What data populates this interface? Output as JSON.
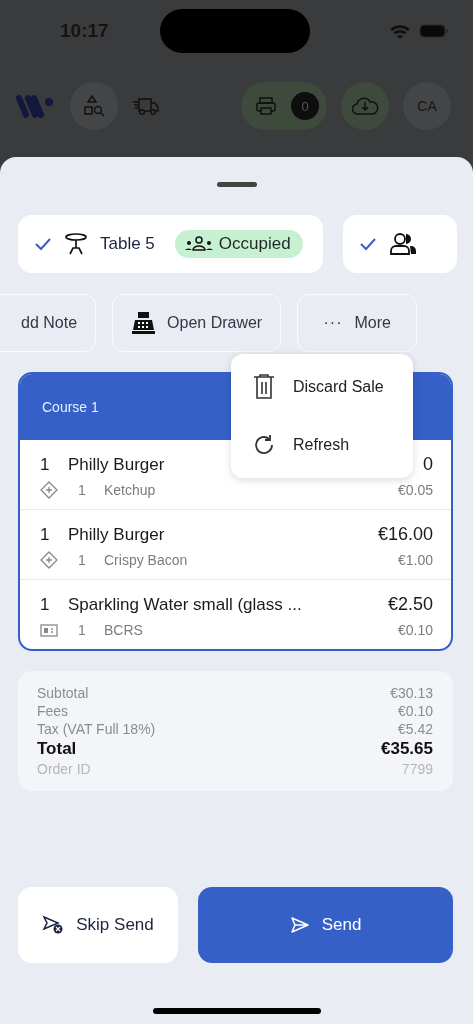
{
  "status_bar": {
    "time": "10:17"
  },
  "top_bar": {
    "print_count": "0",
    "avatar": "CA"
  },
  "chips": [
    {
      "kind": "table",
      "checked": true,
      "label": "Table 5",
      "status": "Occupied"
    },
    {
      "kind": "guests",
      "checked": true
    }
  ],
  "actions": [
    {
      "kind": "note",
      "label": "dd Note"
    },
    {
      "kind": "drawer",
      "label": "Open Drawer"
    },
    {
      "kind": "more",
      "icon": "···",
      "label": "More"
    }
  ],
  "menu": [
    {
      "kind": "trash",
      "label": "Discard Sale"
    },
    {
      "kind": "refresh",
      "label": "Refresh"
    }
  ],
  "course": {
    "title": "Course 1",
    "items": [
      {
        "qty": "1",
        "name": "Philly Burger",
        "price": "0",
        "modifier": {
          "kind": "addon",
          "qty": "1",
          "name": "Ketchup",
          "price": "€0.05"
        }
      },
      {
        "qty": "1",
        "name": "Philly Burger",
        "price": "€16.00",
        "modifier": {
          "kind": "addon",
          "qty": "1",
          "name": "Crispy Bacon",
          "price": "€1.00"
        }
      },
      {
        "qty": "1",
        "name": "Sparkling Water small (glass ...",
        "price": "€2.50",
        "modifier": {
          "kind": "deposit",
          "qty": "1",
          "name": "BCRS",
          "price": "€0.10"
        }
      }
    ]
  },
  "summary": [
    {
      "kind": "line",
      "label": "Subtotal",
      "value": "€30.13"
    },
    {
      "kind": "line",
      "label": "Fees",
      "value": "€0.10"
    },
    {
      "kind": "line",
      "label": "Tax (VAT Full 18%)",
      "value": "€5.42"
    },
    {
      "kind": "total",
      "label": "Total",
      "value": "€35.65"
    },
    {
      "kind": "id",
      "label": "Order ID",
      "value": "7799"
    }
  ],
  "buttons": [
    {
      "kind": "secondary",
      "label": "Skip Send"
    },
    {
      "kind": "primary",
      "label": "Send"
    }
  ]
}
